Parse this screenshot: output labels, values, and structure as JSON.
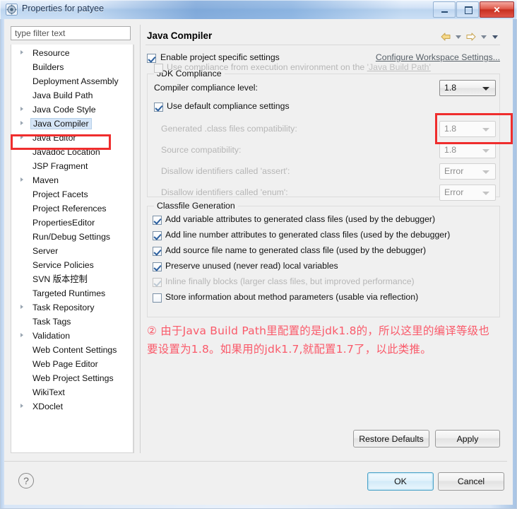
{
  "window": {
    "title": "Properties for patyee",
    "icon": "properties-gear-icon",
    "buttons": {
      "minimize": "minimize-button",
      "maximize": "maximize-button",
      "close_label": "✕"
    }
  },
  "sidebar": {
    "filter": {
      "placeholder": "type filter text",
      "value": ""
    },
    "items": [
      {
        "label": "Resource",
        "expandable": true,
        "selected": false
      },
      {
        "label": "Builders",
        "expandable": false,
        "selected": false
      },
      {
        "label": "Deployment Assembly",
        "expandable": false,
        "selected": false
      },
      {
        "label": "Java Build Path",
        "expandable": false,
        "selected": false
      },
      {
        "label": "Java Code Style",
        "expandable": true,
        "selected": false
      },
      {
        "label": "Java Compiler",
        "expandable": true,
        "selected": true
      },
      {
        "label": "Java Editor",
        "expandable": true,
        "selected": false
      },
      {
        "label": "Javadoc Location",
        "expandable": false,
        "selected": false
      },
      {
        "label": "JSP Fragment",
        "expandable": false,
        "selected": false
      },
      {
        "label": "Maven",
        "expandable": true,
        "selected": false
      },
      {
        "label": "Project Facets",
        "expandable": false,
        "selected": false
      },
      {
        "label": "Project References",
        "expandable": false,
        "selected": false
      },
      {
        "label": "PropertiesEditor",
        "expandable": false,
        "selected": false
      },
      {
        "label": "Run/Debug Settings",
        "expandable": false,
        "selected": false
      },
      {
        "label": "Server",
        "expandable": false,
        "selected": false
      },
      {
        "label": "Service Policies",
        "expandable": false,
        "selected": false
      },
      {
        "label": "SVN 版本控制",
        "expandable": false,
        "selected": false
      },
      {
        "label": "Targeted Runtimes",
        "expandable": false,
        "selected": false
      },
      {
        "label": "Task Repository",
        "expandable": true,
        "selected": false
      },
      {
        "label": "Task Tags",
        "expandable": false,
        "selected": false
      },
      {
        "label": "Validation",
        "expandable": true,
        "selected": false
      },
      {
        "label": "Web Content Settings",
        "expandable": false,
        "selected": false
      },
      {
        "label": "Web Page Editor",
        "expandable": false,
        "selected": false
      },
      {
        "label": "Web Project Settings",
        "expandable": false,
        "selected": false
      },
      {
        "label": "WikiText",
        "expandable": false,
        "selected": false
      },
      {
        "label": "XDoclet",
        "expandable": true,
        "selected": false
      }
    ]
  },
  "page": {
    "title": "Java Compiler",
    "nav": {
      "back_icon": "back-arrow-icon",
      "back_menu_icon": "chevron-down-icon",
      "forward_icon": "forward-arrow-icon",
      "forward_menu_icon": "chevron-down-icon",
      "view_menu_icon": "chevron-down-icon"
    },
    "enable_project_specific": {
      "label": "Enable project specific settings",
      "checked": true
    },
    "configure_workspace_link": "Configure Workspace Settings...",
    "jdk_compliance": {
      "group_title": "JDK Compliance",
      "use_execution_env": {
        "label_prefix": "Use compliance from execution environment on the ",
        "label_link": "'Java Build Path'",
        "checked": false,
        "enabled": false
      },
      "compiler_compliance_level": {
        "label": "Compiler compliance level:",
        "value": "1.8",
        "highlighted": true
      },
      "use_default_compliance": {
        "label": "Use default compliance settings",
        "checked": true
      },
      "disabled_rows": [
        {
          "label": "Generated .class files compatibility:",
          "value": "1.8"
        },
        {
          "label": "Source compatibility:",
          "value": "1.8"
        },
        {
          "label": "Disallow identifiers called 'assert':",
          "value": "Error"
        },
        {
          "label": "Disallow identifiers called 'enum':",
          "value": "Error"
        }
      ]
    },
    "classfile_generation": {
      "group_title": "Classfile Generation",
      "options": [
        {
          "label": "Add variable attributes to generated class files (used by the debugger)",
          "checked": true,
          "enabled": true
        },
        {
          "label": "Add line number attributes to generated class files (used by the debugger)",
          "checked": true,
          "enabled": true
        },
        {
          "label": "Add source file name to generated class file (used by the debugger)",
          "checked": true,
          "enabled": true
        },
        {
          "label": "Preserve unused (never read) local variables",
          "checked": true,
          "enabled": true
        },
        {
          "label": "Inline finally blocks (larger class files, but improved performance)",
          "checked": true,
          "enabled": false
        },
        {
          "label": "Store information about method parameters (usable via reflection)",
          "checked": false,
          "enabled": true
        }
      ]
    },
    "annotation": "② 由于Java Build Path里配置的是jdk1.8的，所以这里的编译等级也要设置为1.8。如果用的jdk1.7,就配置1.7了，以此类推。",
    "restore_defaults_label": "Restore Defaults",
    "apply_label": "Apply"
  },
  "footer": {
    "help_glyph": "?",
    "ok_label": "OK",
    "cancel_label": "Cancel"
  },
  "colors": {
    "highlight_red": "#ef2d2d",
    "annotation_red": "#fa5a6a",
    "selection_blue": "#d5e5f7"
  }
}
